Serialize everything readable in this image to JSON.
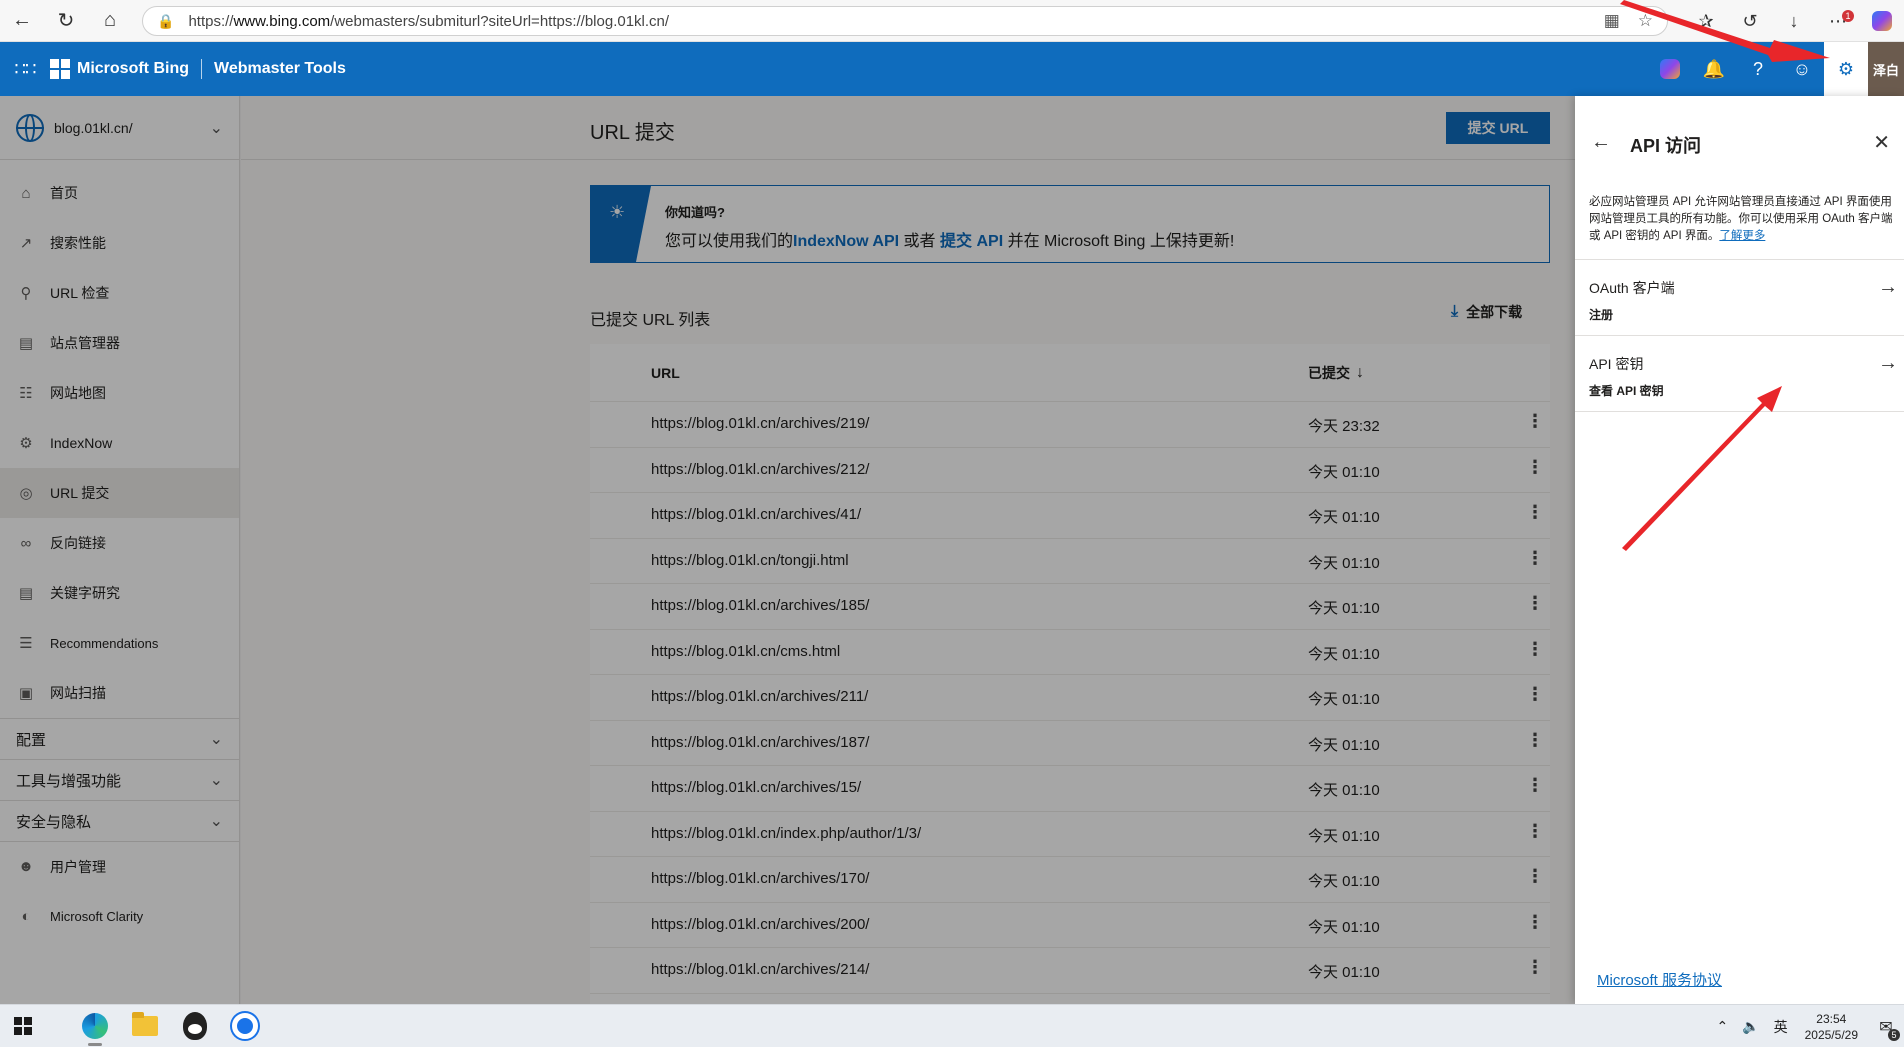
{
  "browser": {
    "url_prefix": "https://",
    "url_host": "www.bing.com",
    "url_path": "/webmasters/submiturl?siteUrl=https://blog.01kl.cn/",
    "notif_count": "1"
  },
  "header": {
    "brand": "Microsoft Bing",
    "product": "Webmaster Tools",
    "avatar_text": "泽白"
  },
  "sidebar": {
    "site": "blog.01kl.cn/",
    "items": [
      {
        "label": "首页",
        "icon": "home-icon"
      },
      {
        "label": "搜索性能",
        "icon": "trend-icon"
      },
      {
        "label": "URL 检查",
        "icon": "search-icon"
      },
      {
        "label": "站点管理器",
        "icon": "document-icon"
      },
      {
        "label": "网站地图",
        "icon": "sitemap-icon"
      },
      {
        "label": "IndexNow",
        "icon": "gear-icon"
      },
      {
        "label": "URL 提交",
        "icon": "globe-icon"
      },
      {
        "label": "反向链接",
        "icon": "link-icon"
      },
      {
        "label": "关键字研究",
        "icon": "document-icon"
      },
      {
        "label": "Recommendations",
        "icon": "list-icon"
      },
      {
        "label": "网站扫描",
        "icon": "scan-icon"
      }
    ],
    "sections": [
      "配置",
      "工具与增强功能",
      "安全与隐私"
    ],
    "bottom_items": [
      {
        "label": "用户管理",
        "icon": "user-icon"
      },
      {
        "label": "Microsoft Clarity",
        "icon": "clarity-icon"
      }
    ]
  },
  "main": {
    "title": "URL 提交",
    "submit_button": "提交 URL",
    "tip": {
      "title": "你知道吗?",
      "text_1": "您可以使用我们的",
      "link_1": "IndexNow API",
      "text_2": " 或者 ",
      "link_2": "提交 API",
      "text_3": " 并在 Microsoft Bing 上保持更新!"
    },
    "list_title": "已提交 URL 列表",
    "download_all": "全部下载",
    "columns": {
      "url": "URL",
      "submitted": "已提交"
    },
    "rows": [
      {
        "url": "https://blog.01kl.cn/archives/219/",
        "date": "今天 23:32"
      },
      {
        "url": "https://blog.01kl.cn/archives/212/",
        "date": "今天 01:10"
      },
      {
        "url": "https://blog.01kl.cn/archives/41/",
        "date": "今天 01:10"
      },
      {
        "url": "https://blog.01kl.cn/tongji.html",
        "date": "今天 01:10"
      },
      {
        "url": "https://blog.01kl.cn/archives/185/",
        "date": "今天 01:10"
      },
      {
        "url": "https://blog.01kl.cn/cms.html",
        "date": "今天 01:10"
      },
      {
        "url": "https://blog.01kl.cn/archives/211/",
        "date": "今天 01:10"
      },
      {
        "url": "https://blog.01kl.cn/archives/187/",
        "date": "今天 01:10"
      },
      {
        "url": "https://blog.01kl.cn/archives/15/",
        "date": "今天 01:10"
      },
      {
        "url": "https://blog.01kl.cn/index.php/author/1/3/",
        "date": "今天 01:10"
      },
      {
        "url": "https://blog.01kl.cn/archives/170/",
        "date": "今天 01:10"
      },
      {
        "url": "https://blog.01kl.cn/archives/200/",
        "date": "今天 01:10"
      },
      {
        "url": "https://blog.01kl.cn/archives/214/",
        "date": "今天 01:10"
      }
    ]
  },
  "panel": {
    "title": "API 访问",
    "description": "必应网站管理员 API 允许网站管理员直接通过 API 界面使用网站管理员工具的所有功能。你可以使用采用 OAuth 客户端或 API 密钥的 API 界面。",
    "learn_more": "了解更多",
    "items": [
      {
        "title": "OAuth 客户端",
        "subtitle": "注册"
      },
      {
        "title": "API 密钥",
        "subtitle": "查看 API 密钥"
      }
    ],
    "footer_link": "Microsoft 服务协议"
  },
  "taskbar": {
    "ime": "英",
    "time": "23:54",
    "date": "2025/5/29",
    "notif_count": "5"
  },
  "colors": {
    "accent": "#0f6cbd",
    "annotation_arrow": "#e8262a"
  }
}
